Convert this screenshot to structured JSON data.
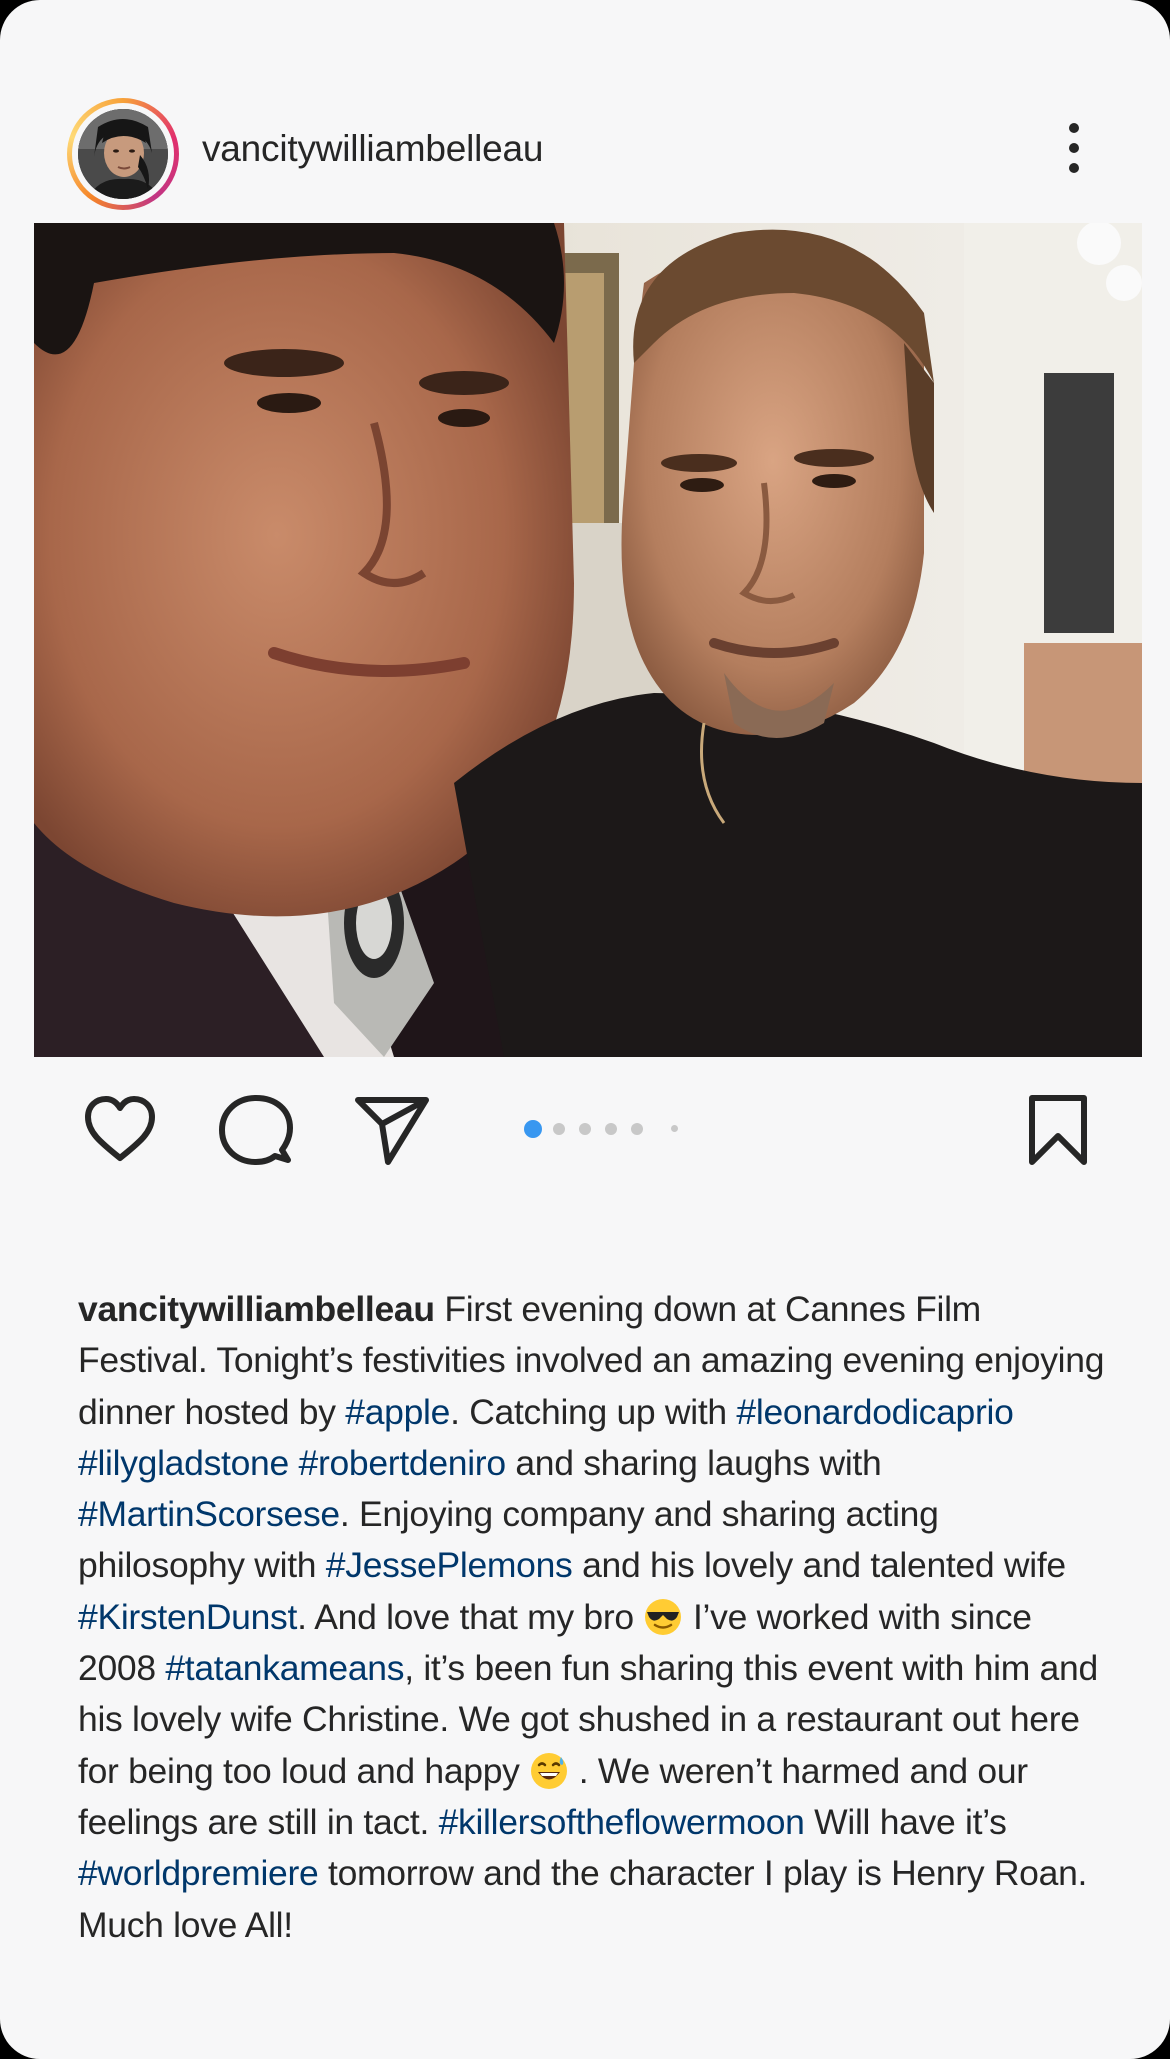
{
  "post": {
    "username": "vancitywilliambelleau",
    "more_icon": "more-vertical-icon",
    "photo_alt": "",
    "carousel": {
      "count": 6,
      "active_index": 0,
      "accent": "#3897f0"
    },
    "actions": {
      "like_icon": "heart-icon",
      "comment_icon": "comment-icon",
      "share_icon": "send-icon",
      "save_icon": "bookmark-icon"
    }
  },
  "caption": {
    "username": "vancitywilliambelleau",
    "t1": " First evening down at Cannes Film Festival. Tonight’s festivities involved an amazing evening enjoying dinner hosted by ",
    "h1": "#apple",
    "t2": ".  Catching up with ",
    "h2": "#leonardodicaprio",
    "t3": " ",
    "h3": "#lilygladstone",
    "t4": " ",
    "h4": "#robertdeniro",
    "t5": " and sharing laughs with ",
    "h5": "#MartinScorsese",
    "t6": ".  Enjoying company and sharing acting philosophy with ",
    "h6": "#JessePlemons",
    "t7": " and his lovely and talented wife ",
    "h7": "#KirstenDunst",
    "t8": ". And love that my bro ",
    "emoji1": "sunglasses-face-emoji",
    "t9": " I’ve worked with  since 2008 ",
    "h8": "#tatankameans",
    "t10": ", it’s been fun sharing this event with him and his lovely wife Christine. We got shushed in a restaurant out here for being too loud and happy ",
    "emoji2": "grinning-sweat-emoji",
    "t11": " . We weren’t harmed and our feelings are still in tact.  ",
    "h9": "#killersoftheflowermoon",
    "t12": " Will have it’s ",
    "h10": "#worldpremiere",
    "t13": " tomorrow and the character I play is Henry Roan. Much love All!",
    "hashtag_color": "#00376b"
  }
}
